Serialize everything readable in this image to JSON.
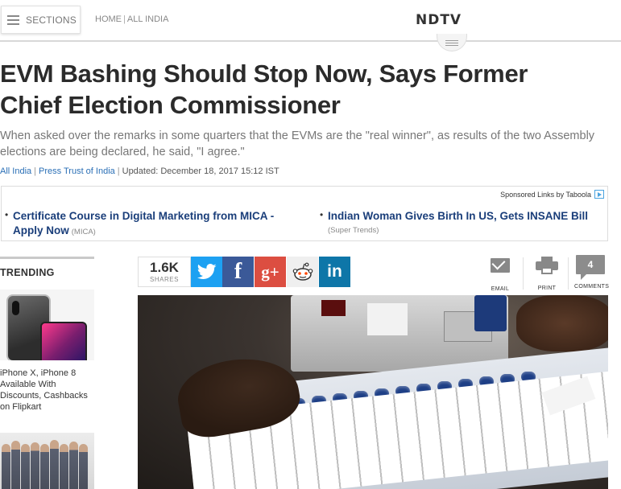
{
  "header": {
    "sections_label": "SECTIONS",
    "breadcrumb_home": "HOME",
    "breadcrumb_separator": "|",
    "breadcrumb_section": "ALL INDIA",
    "logo_text": "NDTV"
  },
  "article": {
    "headline": "EVM Bashing Should Stop Now, Says Former Chief Election Commissioner",
    "summary": "When asked over the remarks in some quarters that the EVMs are the \"real winner\", as results of the two Assembly elections are being declared, he said, \"I agree.\"",
    "byline": {
      "section": "All India",
      "source": "Press Trust of India",
      "updated": "Updated: December 18, 2017 15:12 IST",
      "separator": "|"
    }
  },
  "sponsored": {
    "label": "Sponsored Links by Taboola",
    "items": [
      {
        "title": "Certificate Course in Digital Marketing from MICA - Apply Now",
        "title_line1": "Certificate Course in Digital Marketing from MICA -",
        "title_line2": "Apply Now",
        "source": "(MICA)"
      },
      {
        "title": "Indian Woman Gives Birth In US, Gets INSANE Bill",
        "source": "(Super Trends)"
      }
    ]
  },
  "trending": {
    "title": "TRENDING",
    "items": [
      {
        "text": "iPhone X, iPhone 8 Available With Discounts, Cashbacks on Flipkart"
      }
    ]
  },
  "share": {
    "count": "1.6K",
    "count_label": "SHARES",
    "buttons": [
      {
        "name": "twitter",
        "color": "#1da1f2"
      },
      {
        "name": "facebook",
        "glyph": "f",
        "color": "#3b5998"
      },
      {
        "name": "google-plus",
        "glyph": "g+",
        "color": "#dc4e41"
      },
      {
        "name": "reddit",
        "color": "#efefef"
      },
      {
        "name": "linkedin",
        "glyph": "in",
        "color": "#0e76a8"
      }
    ]
  },
  "tools": {
    "email_label": "EMAIL",
    "print_label": "PRINT",
    "comments_label": "COMMENTS",
    "comments_count": "4"
  },
  "colors": {
    "link_blue": "#1a3e7a",
    "byline_link": "#2a6fb6",
    "divider": "#d8d8d8"
  }
}
